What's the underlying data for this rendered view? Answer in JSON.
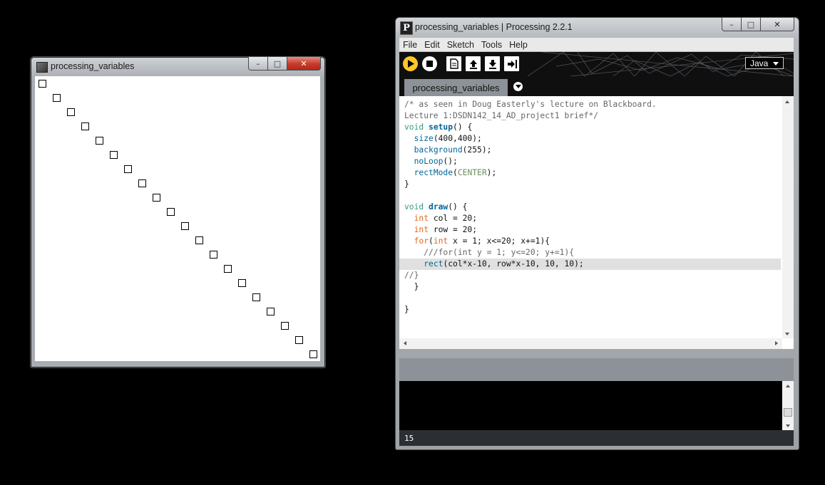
{
  "sketch_window": {
    "title": "processing_variables",
    "buttons": {
      "minimize": "–",
      "maximize": "□",
      "close": "✕"
    },
    "canvas": {
      "background": "#ffffff",
      "squares": {
        "count": 20,
        "col": 20,
        "row": 20,
        "size": 10,
        "offset": 10,
        "stroke": "#000000"
      }
    }
  },
  "ide_window": {
    "title": "processing_variables | Processing 2.2.1",
    "buttons": {
      "minimize": "–",
      "maximize": "□",
      "close": "✕"
    },
    "menu": [
      "File",
      "Edit",
      "Sketch",
      "Tools",
      "Help"
    ],
    "toolbar": {
      "run_icon": "play-icon",
      "stop_icon": "stop-icon",
      "new_icon": "new-file-icon",
      "open_icon": "open-icon",
      "save_icon": "save-icon",
      "export_icon": "export-icon",
      "mode": "Java"
    },
    "tab": {
      "name": "processing_variables"
    },
    "code_lines": [
      "/* as seen in Doug Easterly's lecture on Blackboard.",
      "Lecture 1:DSDN142_14_AD_project1 brief*/",
      "void setup() {",
      "  size(400,400);",
      "  background(255);",
      "  noLoop();",
      "  rectMode(CENTER);",
      "}",
      "",
      "void draw() {",
      "  int col = 20;",
      "  int row = 20;",
      "  for(int x = 1; x<=20; x+=1){",
      "    ///for(int y = 1; y<=20; y+=1){",
      "    rect(col*x-10, row*x-10, 10, 10);",
      "//}",
      "  }",
      "",
      "}"
    ],
    "highlighted_line": 15,
    "status_line": "15",
    "colors": {
      "run_button": "#ffc629",
      "comment": "#666666",
      "keyword": "#33997e",
      "function": "#006699",
      "type": "#e2661a",
      "constant": "#718a62",
      "message_bar": "#8c9298",
      "status_bar": "#2b2f33"
    }
  }
}
